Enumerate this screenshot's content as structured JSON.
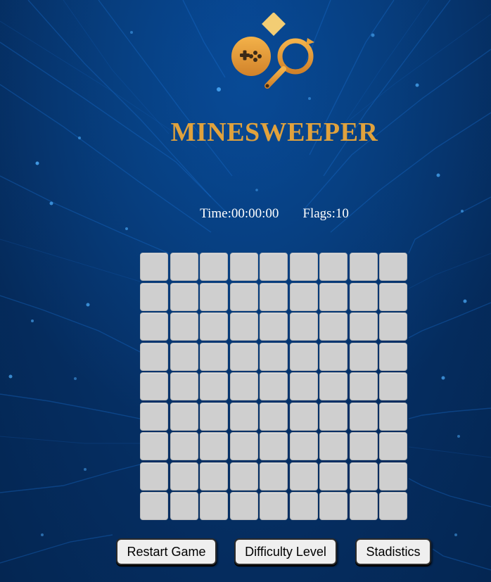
{
  "game": {
    "title": "MINESWEEPER",
    "logo_icon": "gamepad-magnifier-logo-icon",
    "accent_color": "#e0a23d",
    "background_color": "#053064"
  },
  "status": {
    "time_text": "Time:00:00:00",
    "flags_text": "Flags:10"
  },
  "board": {
    "rows": 9,
    "cols": 9,
    "cell_state": "unrevealed",
    "cell_color": "#cfcfcf"
  },
  "buttons": {
    "restart_label": "Restart Game",
    "difficulty_label": "Difficulty Level",
    "statistics_label": "Stadistics"
  }
}
